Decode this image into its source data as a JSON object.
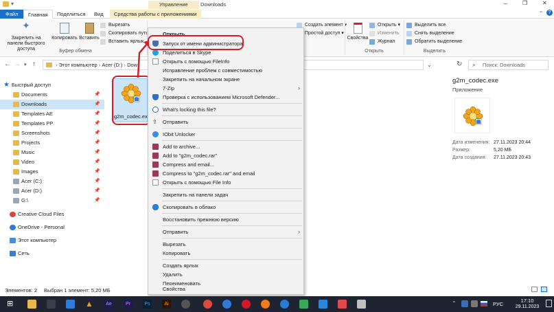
{
  "window": {
    "title": "Downloads",
    "context_tab": "Управление",
    "controls": [
      "–",
      "❐",
      "✕"
    ]
  },
  "ribbon_tabs": [
    {
      "label": "Файл"
    },
    {
      "label": "Главная"
    },
    {
      "label": "Поделиться"
    },
    {
      "label": "Вид"
    },
    {
      "label": "Средства работы с приложениями"
    }
  ],
  "ribbon": {
    "pin_label": "Закрепить на панели быстрого доступа",
    "copy_label": "Копировать",
    "paste_label": "Вставить",
    "cut_label": "Вырезать",
    "copy_path_label": "Скопировать путь",
    "paste_shortcut_label": "Вставить ярлык",
    "clipboard_group": "Буфер обмена",
    "new_item_label": "Создать элемент",
    "easy_access_label": "Простой доступ",
    "properties_label": "Свойства",
    "open_label": "Открыть",
    "edit_label": "Изменить",
    "history_label": "Журнал",
    "open_group": "Открыть",
    "select_all_label": "Выделить все",
    "select_none_label": "Снять выделение",
    "invert_label": "Обратить выделение",
    "select_group": "Выделить"
  },
  "address": {
    "crumbs": [
      "Этот компьютер",
      "Acer (D:)",
      "Dow"
    ],
    "search_placeholder": "Поиск: Downloads"
  },
  "nav": {
    "quick_access": "Быстрый доступ",
    "items": [
      {
        "label": "Documents",
        "pinned": true
      },
      {
        "label": "Downloads",
        "pinned": true
      },
      {
        "label": "Templates AE",
        "pinned": true
      },
      {
        "label": "Templates PP",
        "pinned": true
      },
      {
        "label": "Screenshots",
        "pinned": true
      },
      {
        "label": "Projects",
        "pinned": true
      },
      {
        "label": "Music",
        "pinned": true
      },
      {
        "label": "Video",
        "pinned": true
      },
      {
        "label": "Images",
        "pinned": true
      },
      {
        "label": "Acer (C:)",
        "pinned": true
      },
      {
        "label": "Acer (D:)",
        "pinned": true
      },
      {
        "label": "G:\\",
        "pinned": true
      }
    ],
    "creative_cloud": "Creative Cloud Files",
    "onedrive": "OneDrive - Personal",
    "this_pc": "Этот компьютер",
    "network": "Сеть",
    "pin_glyph": "📌"
  },
  "file": {
    "name": "g2m_codec.exe"
  },
  "details": {
    "title": "g2m_codec.exe",
    "kind": "Приложение",
    "rows": [
      {
        "label": "Дата изменения:",
        "value": "27.11.2023 20:44"
      },
      {
        "label": "Размер:",
        "value": "5,20 МБ"
      },
      {
        "label": "Дата создания:",
        "value": "27.11.2023 20:43"
      }
    ]
  },
  "context_menu": {
    "items": [
      {
        "label": "Открыть",
        "bold": true
      },
      {
        "label": "Запуск от имени администратора",
        "icon": "shield-icon"
      },
      {
        "label": "Поделиться в Skype",
        "icon": "skype-icon"
      },
      {
        "label": "Открыть с помощью FileInfo",
        "icon": "fileinfo-icon"
      },
      {
        "label": "Исправление проблем с совместимостью"
      },
      {
        "label": "Закрепить на начальном экране"
      },
      {
        "label": "7-Zip",
        "submenu": true
      },
      {
        "label": "Проверка с использованием Microsoft Defender...",
        "icon": "defender-icon"
      },
      {
        "label": "What's locking this file?",
        "icon": "lock-search-icon"
      },
      {
        "label": "Отправить",
        "icon": "share-icon"
      },
      {
        "label": "IObit Unlocker",
        "icon": "iobit-icon"
      },
      {
        "label": "Add to archive...",
        "icon": "winrar-icon"
      },
      {
        "label": "Add to \"g2m_codec.rar\"",
        "icon": "winrar-icon"
      },
      {
        "label": "Compress and email...",
        "icon": "winrar-icon"
      },
      {
        "label": "Compress to \"g2m_codec.rar\" and email",
        "icon": "winrar-icon"
      },
      {
        "label": "Открыть с помощью File Info",
        "icon": "fileinfo-icon"
      },
      {
        "label": "Закрепить на панели задач"
      },
      {
        "label": "Скопировать в облако",
        "icon": "cloud-icon"
      },
      {
        "label": "Восстановить прежнюю версию"
      },
      {
        "label": "Отправить",
        "submenu": true
      },
      {
        "label": "Вырезать"
      },
      {
        "label": "Копировать"
      },
      {
        "label": "Создать ярлык"
      },
      {
        "label": "Удалить"
      },
      {
        "label": "Переименовать"
      },
      {
        "label": "Свойства"
      }
    ],
    "submenu_glyph": "›"
  },
  "status": {
    "count": "Элементов: 2",
    "selected": "Выбран 1 элемент: 5,20 МБ"
  },
  "taskbar": {
    "lang": "РУС",
    "time": "17:10",
    "date": "29.11.2023",
    "app_labels": [
      "Ae",
      "Pr",
      "Ps",
      "Ai"
    ]
  },
  "colors": {
    "accent": "#1a6fc9",
    "highlight_red": "#d0202a",
    "selection": "#cce4f7"
  }
}
